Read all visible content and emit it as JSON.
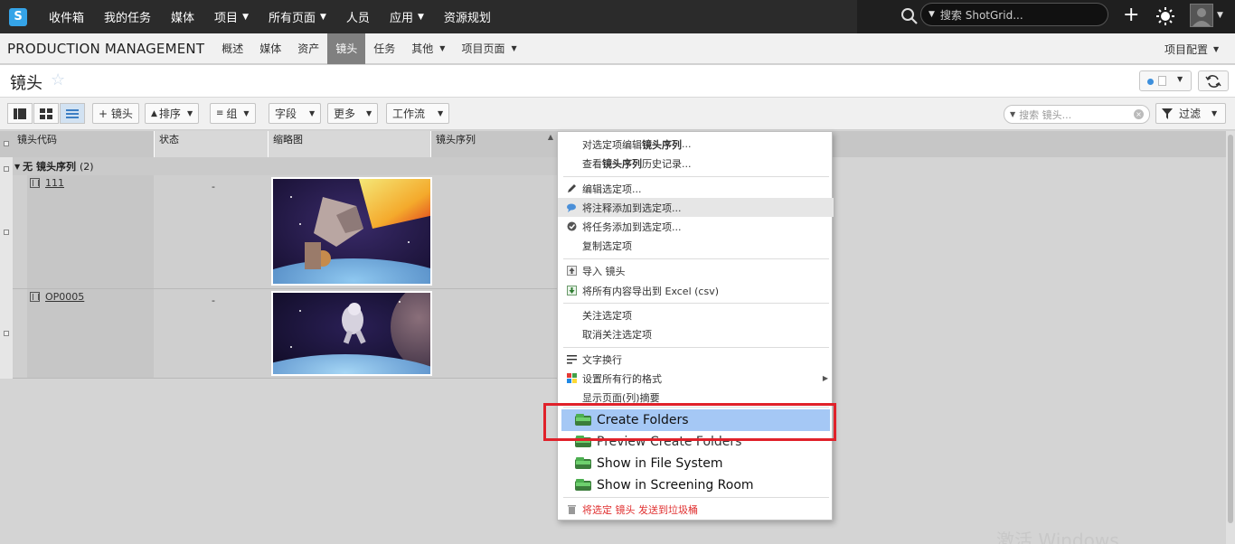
{
  "topnav": {
    "logo": "S",
    "items": [
      {
        "label": "收件箱",
        "caret": false
      },
      {
        "label": "我的任务",
        "caret": false
      },
      {
        "label": "媒体",
        "caret": false
      },
      {
        "label": "项目",
        "caret": true
      },
      {
        "label": "所有页面",
        "caret": true
      },
      {
        "label": "人员",
        "caret": false
      },
      {
        "label": "应用",
        "caret": true
      },
      {
        "label": "资源规划",
        "caret": false
      }
    ],
    "search_placeholder": "搜索 ShotGrid..."
  },
  "projbar": {
    "title": "PRODUCTION MANAGEMENT",
    "tabs": [
      {
        "label": "概述",
        "active": false,
        "caret": false
      },
      {
        "label": "媒体",
        "active": false,
        "caret": false
      },
      {
        "label": "资产",
        "active": false,
        "caret": false
      },
      {
        "label": "镜头",
        "active": true,
        "caret": false
      },
      {
        "label": "任务",
        "active": false,
        "caret": false
      },
      {
        "label": "其他",
        "active": false,
        "caret": true
      },
      {
        "label": "项目页面",
        "active": false,
        "caret": true
      }
    ],
    "config": "项目配置"
  },
  "page": {
    "title": "镜头"
  },
  "toolbar": {
    "add_shot": "+ 镜头",
    "sort": "排序",
    "group": "组",
    "fields": "字段",
    "more": "更多",
    "workflow": "工作流",
    "search_placeholder": "搜索 镜头...",
    "filter": "过滤"
  },
  "grid": {
    "columns": [
      "镜头代码",
      "状态",
      "缩略图",
      "镜头序列"
    ],
    "group": {
      "label": "无 镜头序列",
      "count": "(2)"
    },
    "rows": [
      {
        "code": "111",
        "status": "-"
      },
      {
        "code": "OP0005",
        "status": "-"
      }
    ]
  },
  "context_menu": {
    "edit_seq_prefix": "对选定项编辑 ",
    "edit_seq_bold": "镜头序列",
    "edit_seq_suffix": "...",
    "history_prefix": "查看 ",
    "history_bold": "镜头序列",
    "history_suffix": " 历史记录...",
    "edit_selected": "编辑选定项...",
    "add_note": "将注释添加到选定项...",
    "add_task": "将任务添加到选定项...",
    "duplicate": "复制选定项",
    "import": "导入 镜头",
    "export": "将所有内容导出到 Excel (csv)",
    "follow": "关注选定项",
    "unfollow": "取消关注选定项",
    "wrap": "文字换行",
    "format": "设置所有行的格式",
    "summary": "显示页面(列)摘要",
    "create_folders": "Create Folders",
    "preview_folders": "Preview Create Folders",
    "show_fs": "Show in File System",
    "show_screening": "Show in Screening Room",
    "trash": "将选定 镜头 发送到垃圾桶"
  },
  "watermark": "激活 Windows",
  "colors": {
    "topnav": "#2b2b2b",
    "active_tab": "#808080",
    "accent_blue": "#35a4e8",
    "highlight": "#a5c8f5",
    "annotation_red": "#e0212a"
  }
}
